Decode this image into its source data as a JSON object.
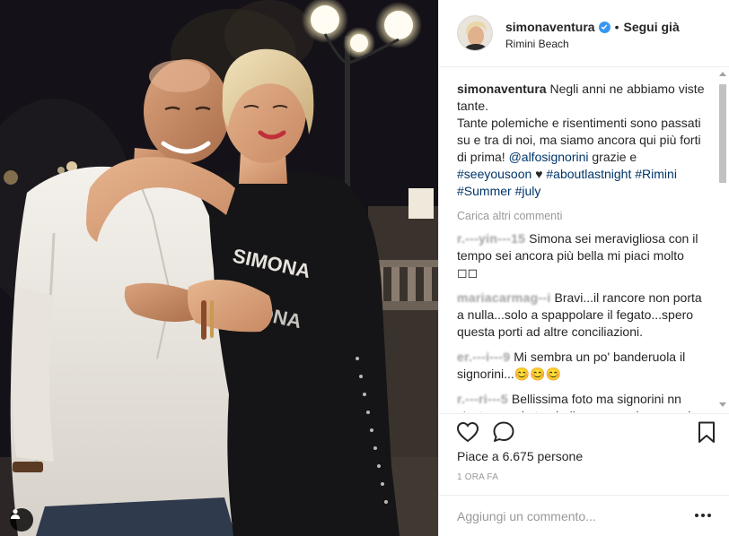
{
  "post": {
    "username": "simonaventura",
    "follow_label": "Segui già",
    "separator": "•",
    "location": "Rimini Beach",
    "caption": {
      "username": "simonaventura",
      "line1": "Negli anni ne abbiamo viste tante.",
      "line2": "Tante polemiche e risentimenti sono passati su e tra di noi, ma siamo ancora qui più forti di prima!",
      "mention": "@alfosignorini",
      "after_mention": "grazie e",
      "tag1": "#seeyousoon",
      "heart": "♥",
      "tag2": "#aboutlastnight",
      "tag3": "#Rimini",
      "tag4": "#Summer",
      "tag5": "#july"
    },
    "load_more": "Carica altri commenti",
    "comments": [
      {
        "user": "r.---yin---15",
        "text": "Simona sei meravigliosa con il tempo sei ancora più bella mi piaci molto ◻◻"
      },
      {
        "user": "mariacarmag--i",
        "text": "Bravi...il rancore non porta a nulla...solo a spappolare il fegato...spero questa porti ad altre conciliazioni."
      },
      {
        "user": "er.---i---9",
        "text": "Mi sembra un po' banderuola il signorini...😊😊😊"
      },
      {
        "user": "r.---ri---5",
        "text": "Bellissima foto ma signorini nn c'entra con la tua bellezza .... sei sempre la"
      }
    ],
    "likes_text": "Piace a 6.675 persone",
    "time_text": "1 ORA FA",
    "comment_placeholder": "Aggiungi un commento..."
  },
  "photo": {
    "shirt_text_line1": "SIMONA",
    "shirt_text_line2": "SIMONA"
  },
  "icons": {
    "like": "heart-icon",
    "comment": "comment-bubble-icon",
    "save": "bookmark-icon",
    "verified": "verified-badge-icon",
    "tag": "user-tag-icon",
    "more": "more-options-icon"
  },
  "colors": {
    "link": "#003569",
    "verified": "#3897f0",
    "muted": "#999999",
    "text": "#262626"
  }
}
